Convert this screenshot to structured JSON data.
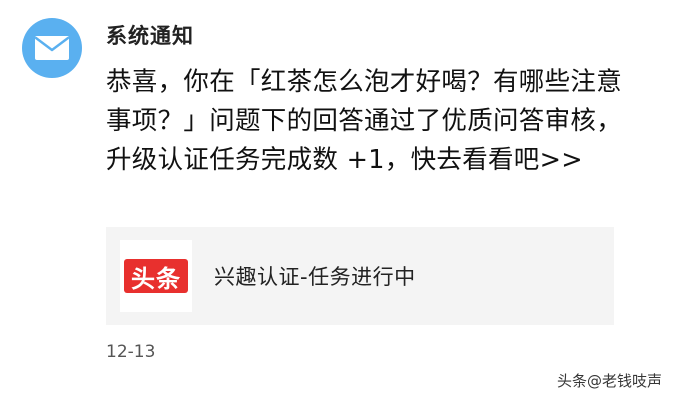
{
  "notification": {
    "sender": "系统通知",
    "avatar_icon": "mail-icon",
    "message": "恭喜，你在「红茶怎么泡才好喝？有哪些注意事项？」问题下的回答通过了优质问答审核，升级认证任务完成数 +1，快去看看吧>>",
    "card": {
      "logo_text": "头条",
      "title": "兴趣认证-任务进行中"
    },
    "date": "12-13"
  },
  "watermark": "头条@老钱吱声",
  "colors": {
    "avatar": "#5ab0f0",
    "logo": "#e8302e",
    "card_bg": "#f4f4f4"
  }
}
